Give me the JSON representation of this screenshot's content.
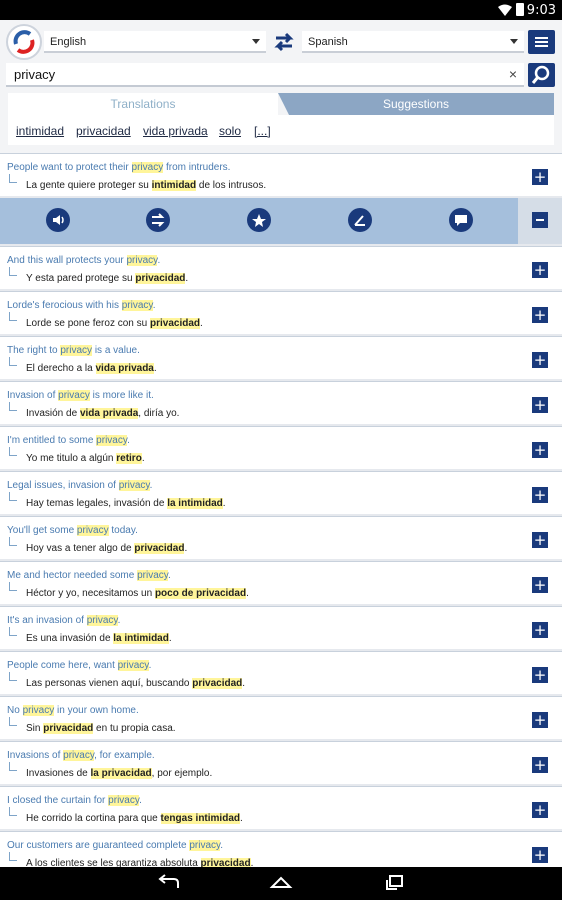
{
  "status": {
    "time": "9:03"
  },
  "languages": {
    "source": "English",
    "target": "Spanish"
  },
  "search": {
    "query": "privacy",
    "clear": "×"
  },
  "tabs": {
    "translations": "Translations",
    "suggestions": "Suggestions"
  },
  "translations": [
    "intimidad",
    "privacidad",
    "vida privada",
    "solo",
    "[...]"
  ],
  "icons": {
    "actions": [
      "speaker-icon",
      "swap-icon",
      "star-icon",
      "share-icon",
      "chat-icon"
    ]
  },
  "colors": {
    "primary": "#1a3a7c",
    "highlight": "#fff59a",
    "source_text": "#4a7bb0"
  },
  "rows": [
    {
      "en": [
        "People want to protect their ",
        "privacy",
        " from intruders."
      ],
      "es": [
        "La gente quiere proteger su ",
        "intimidad",
        " de los intrusos."
      ]
    },
    {
      "en": [
        "And this wall protects your ",
        "privacy",
        "."
      ],
      "es": [
        "Y esta pared protege su ",
        "privacidad",
        "."
      ]
    },
    {
      "en": [
        "Lorde's ferocious with his ",
        "privacy",
        "."
      ],
      "es": [
        "Lorde se pone feroz con su ",
        "privacidad",
        "."
      ]
    },
    {
      "en": [
        "The right to ",
        "privacy",
        " is a value."
      ],
      "es": [
        "El derecho a la ",
        "vida privada",
        "."
      ]
    },
    {
      "en": [
        "Invasion of ",
        "privacy",
        " is more like it."
      ],
      "es": [
        "Invasión de ",
        "vida privada",
        ", diría yo."
      ]
    },
    {
      "en": [
        "I'm entitled to some ",
        "privacy",
        "."
      ],
      "es": [
        "Yo me titulo a algún ",
        "retiro",
        "."
      ]
    },
    {
      "en": [
        "Legal issues, invasion of ",
        "privacy",
        "."
      ],
      "es": [
        "Hay temas legales, invasión de ",
        "la intimidad",
        "."
      ]
    },
    {
      "en": [
        "You'll get some ",
        "privacy",
        " today."
      ],
      "es": [
        "Hoy vas a tener algo de ",
        "privacidad",
        "."
      ]
    },
    {
      "en": [
        "Me and hector needed some ",
        "privacy",
        "."
      ],
      "es": [
        "Héctor y yo, necesitamos un ",
        "poco de privacidad",
        "."
      ]
    },
    {
      "en": [
        "It's an invasion of ",
        "privacy",
        "."
      ],
      "es": [
        "Es una invasión de ",
        "la intimidad",
        "."
      ]
    },
    {
      "en": [
        "People come here, want ",
        "privacy",
        "."
      ],
      "es": [
        "Las personas vienen aquí, buscando ",
        "privacidad",
        "."
      ]
    },
    {
      "en": [
        "No ",
        "privacy",
        " in your own home."
      ],
      "es": [
        "Sin ",
        "privacidad",
        " en tu propia casa."
      ]
    },
    {
      "en": [
        "Invasions of ",
        "privacy",
        ", for example."
      ],
      "es": [
        "Invasiones de ",
        "la privacidad",
        ", por ejemplo."
      ]
    },
    {
      "en": [
        "I closed the curtain for ",
        "privacy",
        "."
      ],
      "es": [
        "He corrido la cortina para que ",
        "tengas intimidad",
        "."
      ]
    },
    {
      "en": [
        "Our customers are guaranteed complete ",
        "privacy",
        "."
      ],
      "es": [
        "A los clientes se les garantiza absoluta ",
        "privacidad",
        "."
      ]
    }
  ],
  "expand_label": "+"
}
